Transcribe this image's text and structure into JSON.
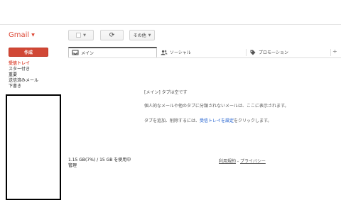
{
  "app": {
    "logo": "Gmail"
  },
  "toolbar": {
    "refresh_symbol": "⟳",
    "more_label": "その他"
  },
  "compose": {
    "label": "作成"
  },
  "nav": {
    "items": [
      {
        "label": "受信トレイ",
        "active": true
      },
      {
        "label": "スター付き"
      },
      {
        "label": "重要"
      },
      {
        "label": "送信済みメール"
      },
      {
        "label": "下書き"
      }
    ]
  },
  "tabs": [
    {
      "label": "メイン",
      "icon": "inbox-icon",
      "active": true
    },
    {
      "label": "ソーシャル",
      "icon": "people-icon"
    },
    {
      "label": "プロモーション",
      "icon": "tag-icon"
    }
  ],
  "tab_add": "+",
  "empty_state": {
    "line1": "[メイン] タブは空です",
    "line2": "個人的なメールや他のタブに分類されないメールは、ここに表示されます。",
    "line3_prefix": "タブを追加、削除するには、",
    "line3_link": "受信トレイを設定",
    "line3_suffix": "をクリックします。"
  },
  "footer": {
    "storage": "1.15 GB(7%) / 15 GB を使用中",
    "manage": "管理",
    "terms": "利用規約",
    "separator": " - ",
    "privacy": "プライバシー"
  },
  "colors": {
    "brand": "#dd4b39",
    "compose_bg": "#d14836",
    "link": "#1155cc"
  }
}
